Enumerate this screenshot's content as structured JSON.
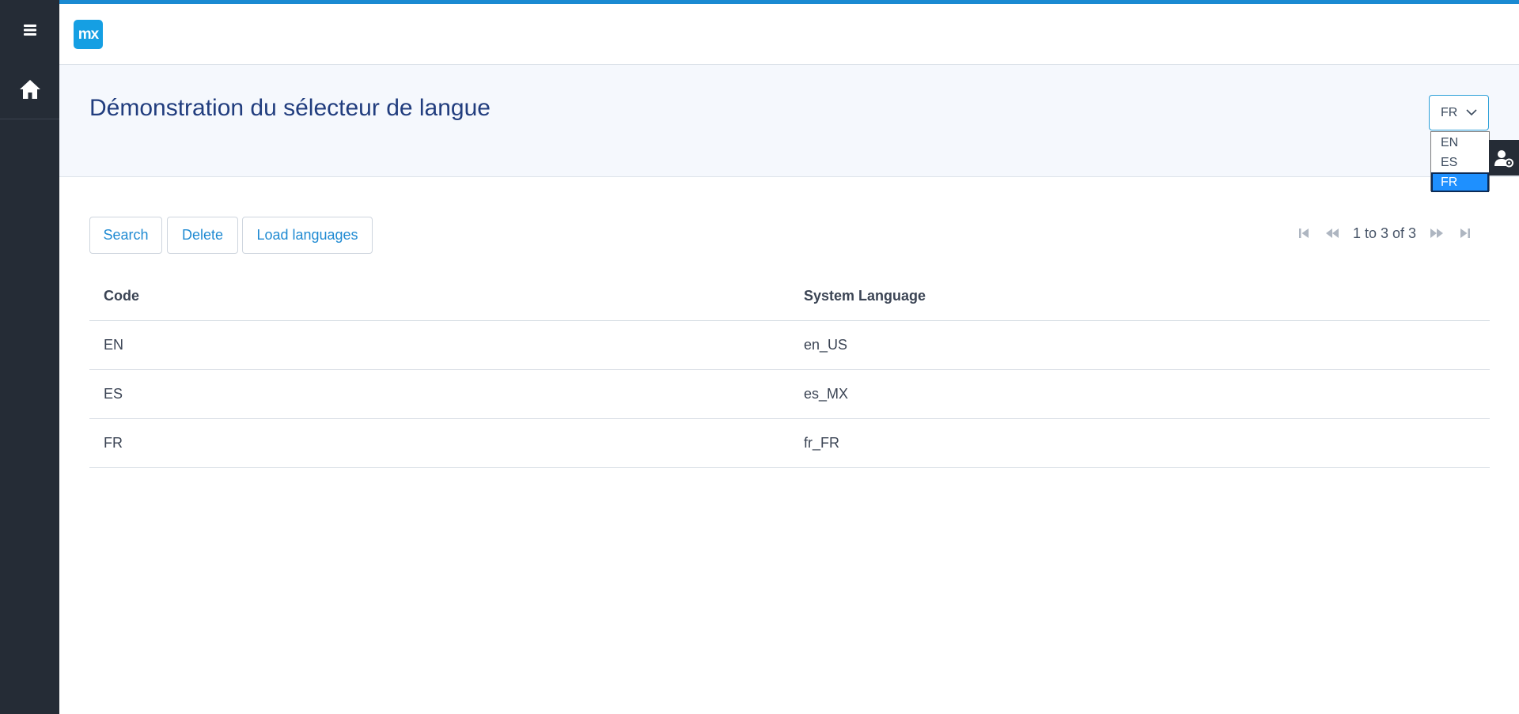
{
  "header": {
    "logo_text": "mx"
  },
  "page": {
    "title": "Démonstration du sélecteur de langue"
  },
  "language_select": {
    "selected": "FR",
    "options": [
      "EN",
      "ES",
      "FR"
    ]
  },
  "toolbar": {
    "search_label": "Search",
    "delete_label": "Delete",
    "load_label": "Load languages"
  },
  "pagination": {
    "text": "1 to 3 of 3"
  },
  "grid": {
    "columns": [
      "Code",
      "System Language"
    ],
    "rows": [
      [
        "EN",
        "en_US"
      ],
      [
        "ES",
        "es_MX"
      ],
      [
        "FR",
        "fr_FR"
      ]
    ]
  },
  "icons": {
    "menu": "hamburger-icon",
    "home": "home-icon",
    "user": "user-settings-icon",
    "first": "first-page-icon",
    "prev": "previous-page-icon",
    "next": "next-page-icon",
    "last": "last-page-icon",
    "chevron": "chevron-down-icon"
  },
  "colors": {
    "sidebar": "#252c36",
    "accent": "#1a8ad2",
    "title": "#213d7e",
    "selected_option": "#1e90ff"
  }
}
